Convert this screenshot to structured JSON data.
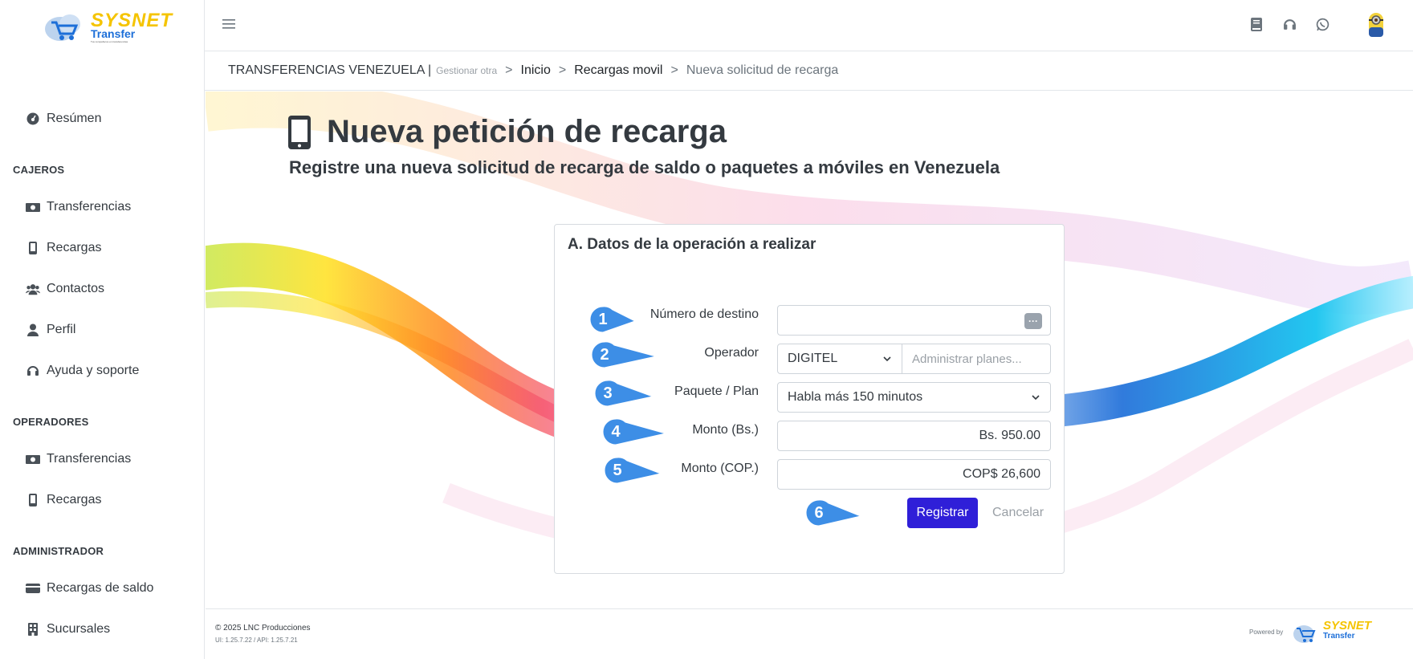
{
  "app": {
    "brand_top": "SYSNET",
    "brand_bottom": "Transfer",
    "brand_tagline": "Tus compañeros en transferencias"
  },
  "sidebar": {
    "items": [
      {
        "label": "Resúmen",
        "icon": "dashboard-icon"
      },
      {
        "section": "CAJEROS"
      },
      {
        "label": "Transferencias",
        "icon": "money-icon"
      },
      {
        "label": "Recargas",
        "icon": "mobile-icon"
      },
      {
        "label": "Contactos",
        "icon": "users-icon"
      },
      {
        "label": "Perfil",
        "icon": "user-icon"
      },
      {
        "label": "Ayuda y soporte",
        "icon": "headset-icon"
      },
      {
        "section": "OPERADORES"
      },
      {
        "label": "Transferencias",
        "icon": "money-icon"
      },
      {
        "label": "Recargas",
        "icon": "mobile-icon"
      },
      {
        "section": "ADMINISTRADOR"
      },
      {
        "label": "Recargas de saldo",
        "icon": "credit-card-icon"
      },
      {
        "label": "Sucursales",
        "icon": "building-icon"
      }
    ]
  },
  "topbar": {
    "menu_icon": "hamburger-icon",
    "icons": [
      "book-icon",
      "headset-icon",
      "whatsapp-icon"
    ],
    "avatar": "avatar-minion"
  },
  "breadcrumb": {
    "root": "TRANSFERENCIAS VENEZUELA |",
    "root_sub": "Gestionar otra",
    "items": [
      "Inicio",
      "Recargas movil"
    ],
    "current": "Nueva solicitud de recarga",
    "separator": ">"
  },
  "page": {
    "title": "Nueva petición de recarga",
    "subtitle": "Registre una nueva solicitud de recarga de saldo o paquetes a móviles en Venezuela"
  },
  "form": {
    "card_title": "A. Datos de la operación a realizar",
    "numero_label": "Número de destino",
    "numero_value": "",
    "operador_label": "Operador",
    "operador_value": "DIGITEL",
    "planes_placeholder": "Administrar planes...",
    "paquete_label": "Paquete / Plan",
    "paquete_value": "Habla más 150 minutos",
    "monto_bs_label": "Monto (Bs.)",
    "monto_bs_value": "Bs. 950.00",
    "monto_cop_label": "Monto (COP.)",
    "monto_cop_value": "COP$ 26,600",
    "submit_label": "Registrar",
    "cancel_label": "Cancelar",
    "more_button": "···"
  },
  "callouts": [
    "1",
    "2",
    "3",
    "4",
    "5",
    "6"
  ],
  "colors": {
    "primary": "#2f1fd8",
    "callout": "#3d8ee6",
    "brand_yellow": "#f5c400",
    "brand_blue": "#1d6fd8"
  },
  "footer": {
    "copyright": "© 2025 LNC Producciones",
    "version": "UI: 1.25.7.22 / API: 1.25.7.21",
    "powered": "Powered by"
  }
}
